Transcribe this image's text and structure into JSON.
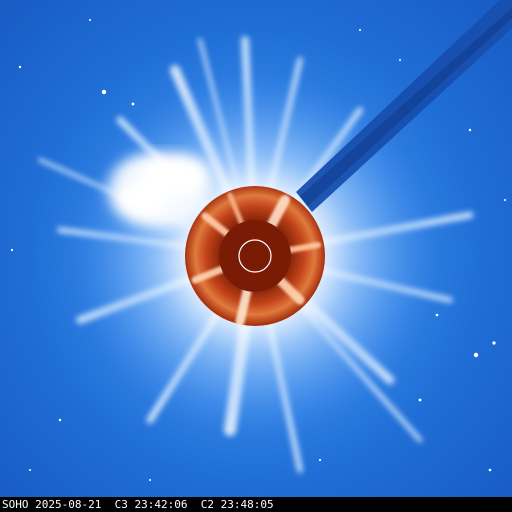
{
  "caption": {
    "observatory": "SOHO",
    "date": "2025-08-21",
    "c3_label": "C3",
    "c3_time": "23:42:06",
    "c2_label": "C2",
    "c2_time": "23:48:05"
  },
  "colors": {
    "c3_background": "#1e6fd6",
    "c3_corona": "#d8ecff",
    "c2_disk": "#b0300f",
    "c2_highlight": "#ffd9b8",
    "occulter": "#8a2208",
    "caption_bg": "#000000",
    "caption_text": "#ffffff"
  }
}
